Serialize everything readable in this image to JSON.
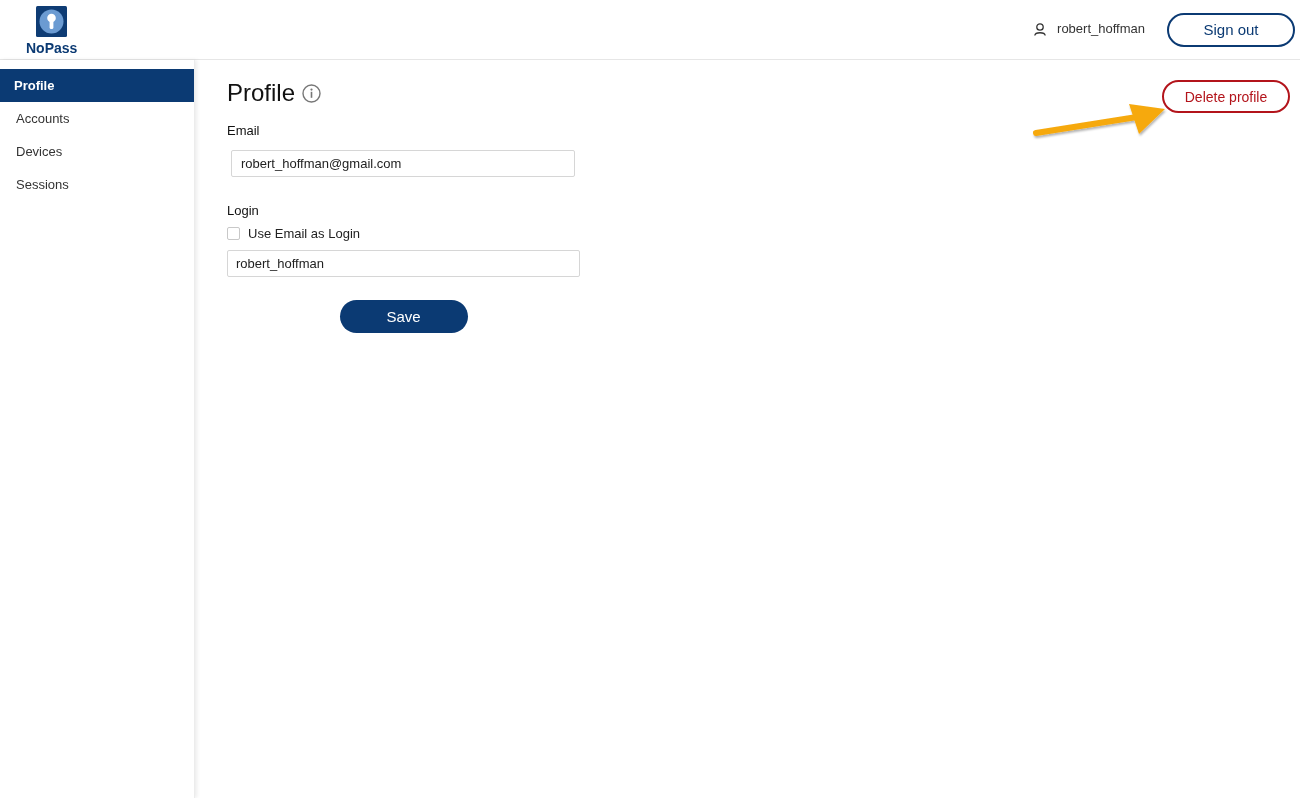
{
  "header": {
    "logo_text": "NoPass",
    "user": {
      "name": "robert_hoffman"
    },
    "sign_out": "Sign out"
  },
  "sidebar": {
    "items": [
      {
        "label": "Profile",
        "selected": true
      },
      {
        "label": "Accounts",
        "selected": false
      },
      {
        "label": "Devices",
        "selected": false
      },
      {
        "label": "Sessions",
        "selected": false
      }
    ]
  },
  "page": {
    "title": "Profile",
    "delete_button": "Delete profile"
  },
  "form": {
    "email": {
      "label": "Email",
      "value": "robert_hoffman@gmail.com"
    },
    "login": {
      "label": "Login",
      "use_email": {
        "label": "Use Email as Login",
        "checked": false
      },
      "value": "robert_hoffman"
    },
    "save": "Save"
  }
}
